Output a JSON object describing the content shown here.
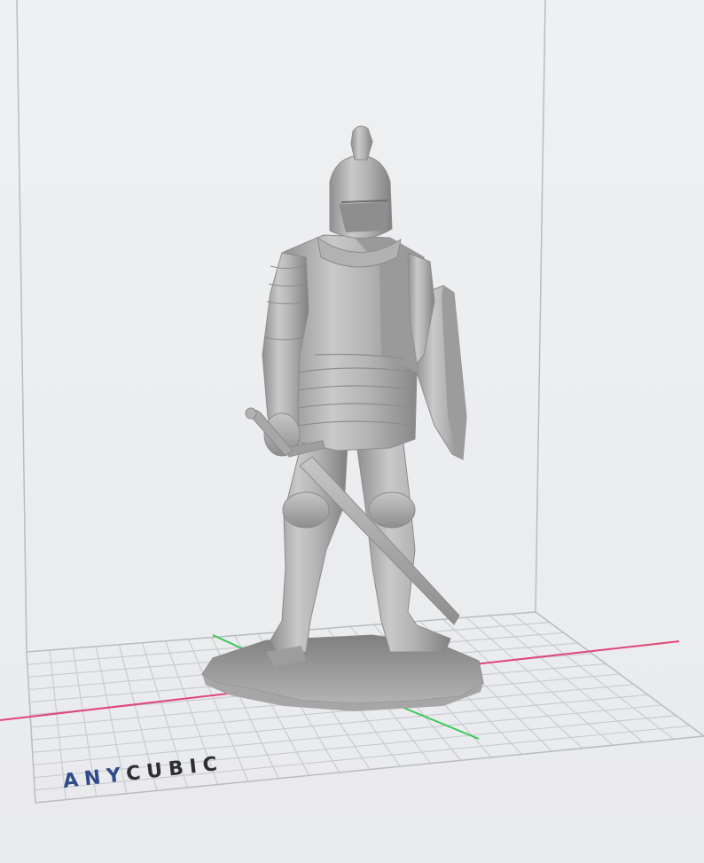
{
  "viewport": {
    "background": "#ecedf0",
    "grid_color": "#c7c9cd",
    "frame_color": "#b9bcc0",
    "x_axis_color": "#e0457a",
    "y_axis_color": "#3cc85a",
    "model_color": "#a9a9a9"
  },
  "model": {
    "name": "knight-figure",
    "description_visible": false
  },
  "brand": {
    "part1": "ANY",
    "part2": "CUBIC",
    "color_part1": "#2f4a8a",
    "color_part2": "#2d2f35"
  }
}
